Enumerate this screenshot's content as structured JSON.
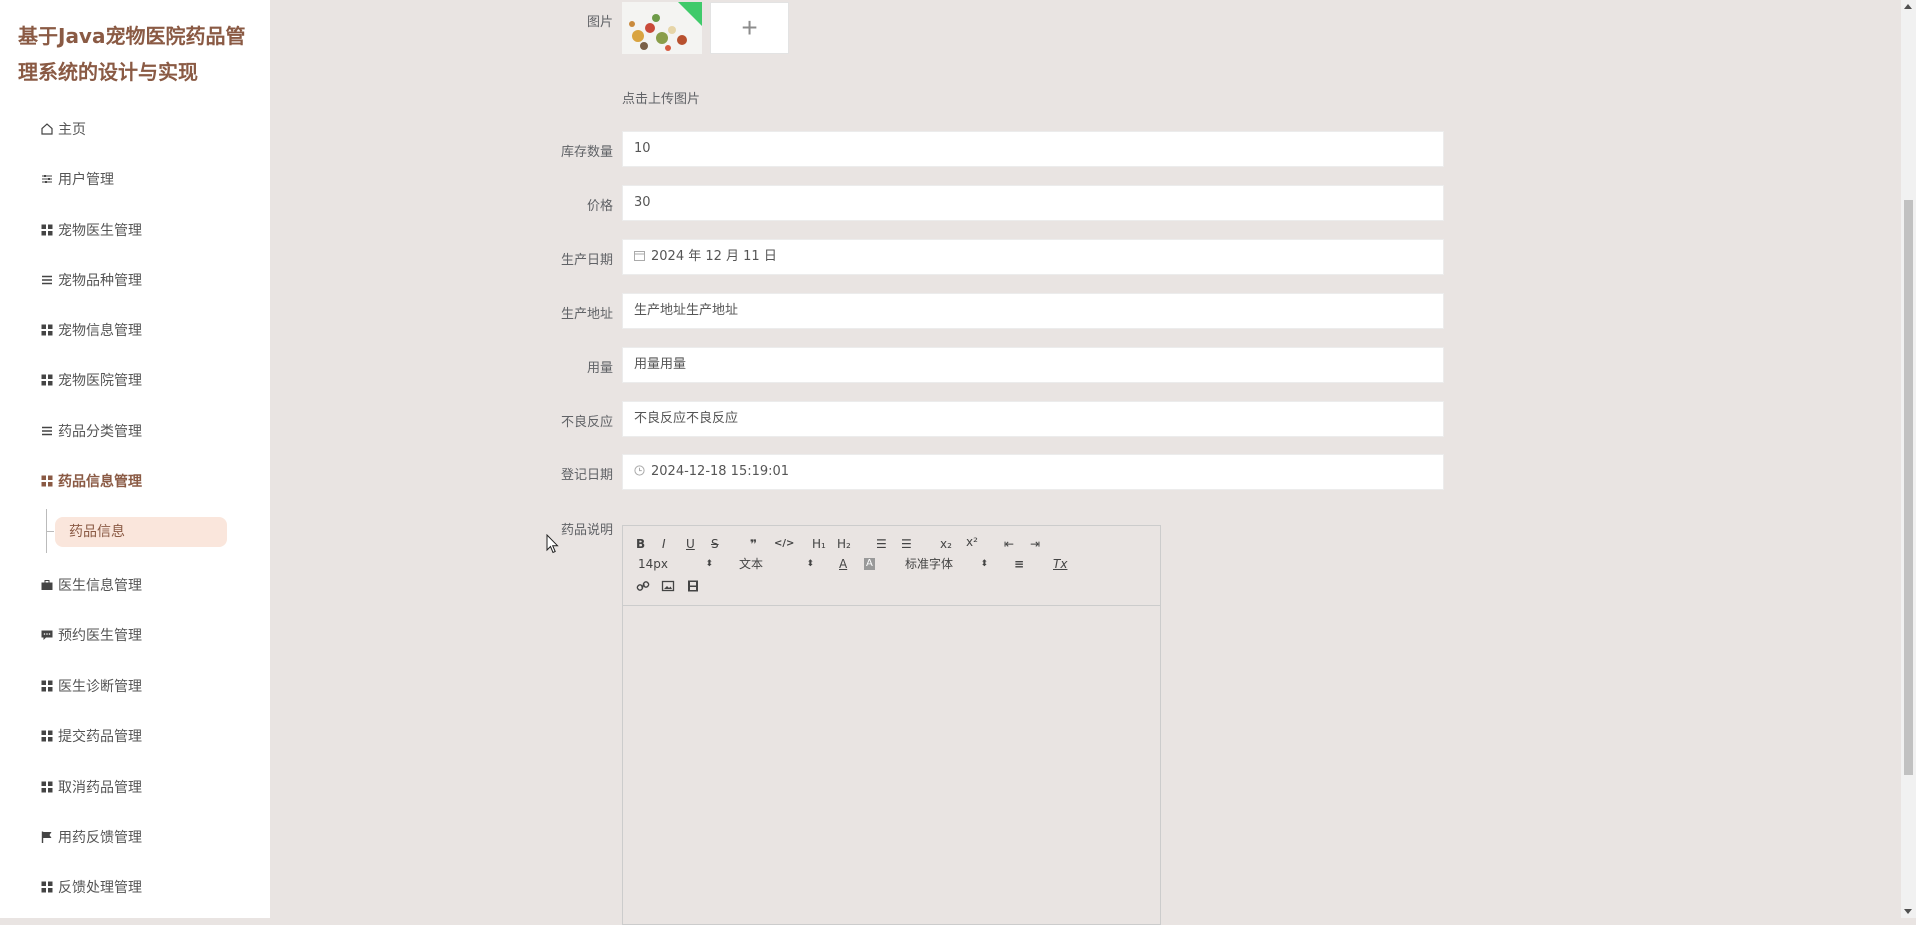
{
  "app": {
    "title": "基于Java宠物医院药品管理系统的设计与实现"
  },
  "sidebar": {
    "items": [
      {
        "label": "主页",
        "icon": "home-icon"
      },
      {
        "label": "用户管理",
        "icon": "sliders-icon"
      },
      {
        "label": "宠物医生管理",
        "icon": "grid-icon"
      },
      {
        "label": "宠物品种管理",
        "icon": "list-icon"
      },
      {
        "label": "宠物信息管理",
        "icon": "grid-icon"
      },
      {
        "label": "宠物医院管理",
        "icon": "grid-icon"
      },
      {
        "label": "药品分类管理",
        "icon": "list-icon"
      },
      {
        "label": "药品信息管理",
        "icon": "grid-icon"
      },
      {
        "label": "医生信息管理",
        "icon": "briefcase-icon"
      },
      {
        "label": "预约医生管理",
        "icon": "chat-icon"
      },
      {
        "label": "医生诊断管理",
        "icon": "grid-icon"
      },
      {
        "label": "提交药品管理",
        "icon": "grid-icon"
      },
      {
        "label": "取消药品管理",
        "icon": "grid-icon"
      },
      {
        "label": "用药反馈管理",
        "icon": "flag-icon"
      },
      {
        "label": "反馈处理管理",
        "icon": "grid-icon"
      }
    ],
    "sub_item": "药品信息"
  },
  "form": {
    "image_label": "图片",
    "upload_plus": "+",
    "upload_hint": "点击上传图片",
    "stock_label": "库存数量",
    "stock_value": "10",
    "price_label": "价格",
    "price_value": "30",
    "prod_date_label": "生产日期",
    "prod_date_value": "2024 年 12 月 11 日",
    "prod_addr_label": "生产地址",
    "prod_addr_value": "生产地址生产地址",
    "dosage_label": "用量",
    "dosage_value": "用量用量",
    "adverse_label": "不良反应",
    "adverse_value": "不良反应不良反应",
    "reg_date_label": "登记日期",
    "reg_date_value": "2024-12-18 15:19:01",
    "desc_label": "药品说明"
  },
  "editor": {
    "bold": "B",
    "italic": "I",
    "underline": "U",
    "strike": "S",
    "quote": "❞",
    "code": "</>",
    "h1": "H₁",
    "h2": "H₂",
    "ordered": "☰",
    "bullet": "☰",
    "sub": "x₂",
    "sup": "x²",
    "outdent": "⇤",
    "indent": "⇥",
    "size": "14px",
    "header": "文本",
    "color": "A",
    "bg": "A",
    "font": "标准字体",
    "align": "≡",
    "clean": "Tx"
  },
  "colors": {
    "accent": "#8a5a44",
    "active_bg": "#fae6dc",
    "background": "#e9e4e2"
  }
}
